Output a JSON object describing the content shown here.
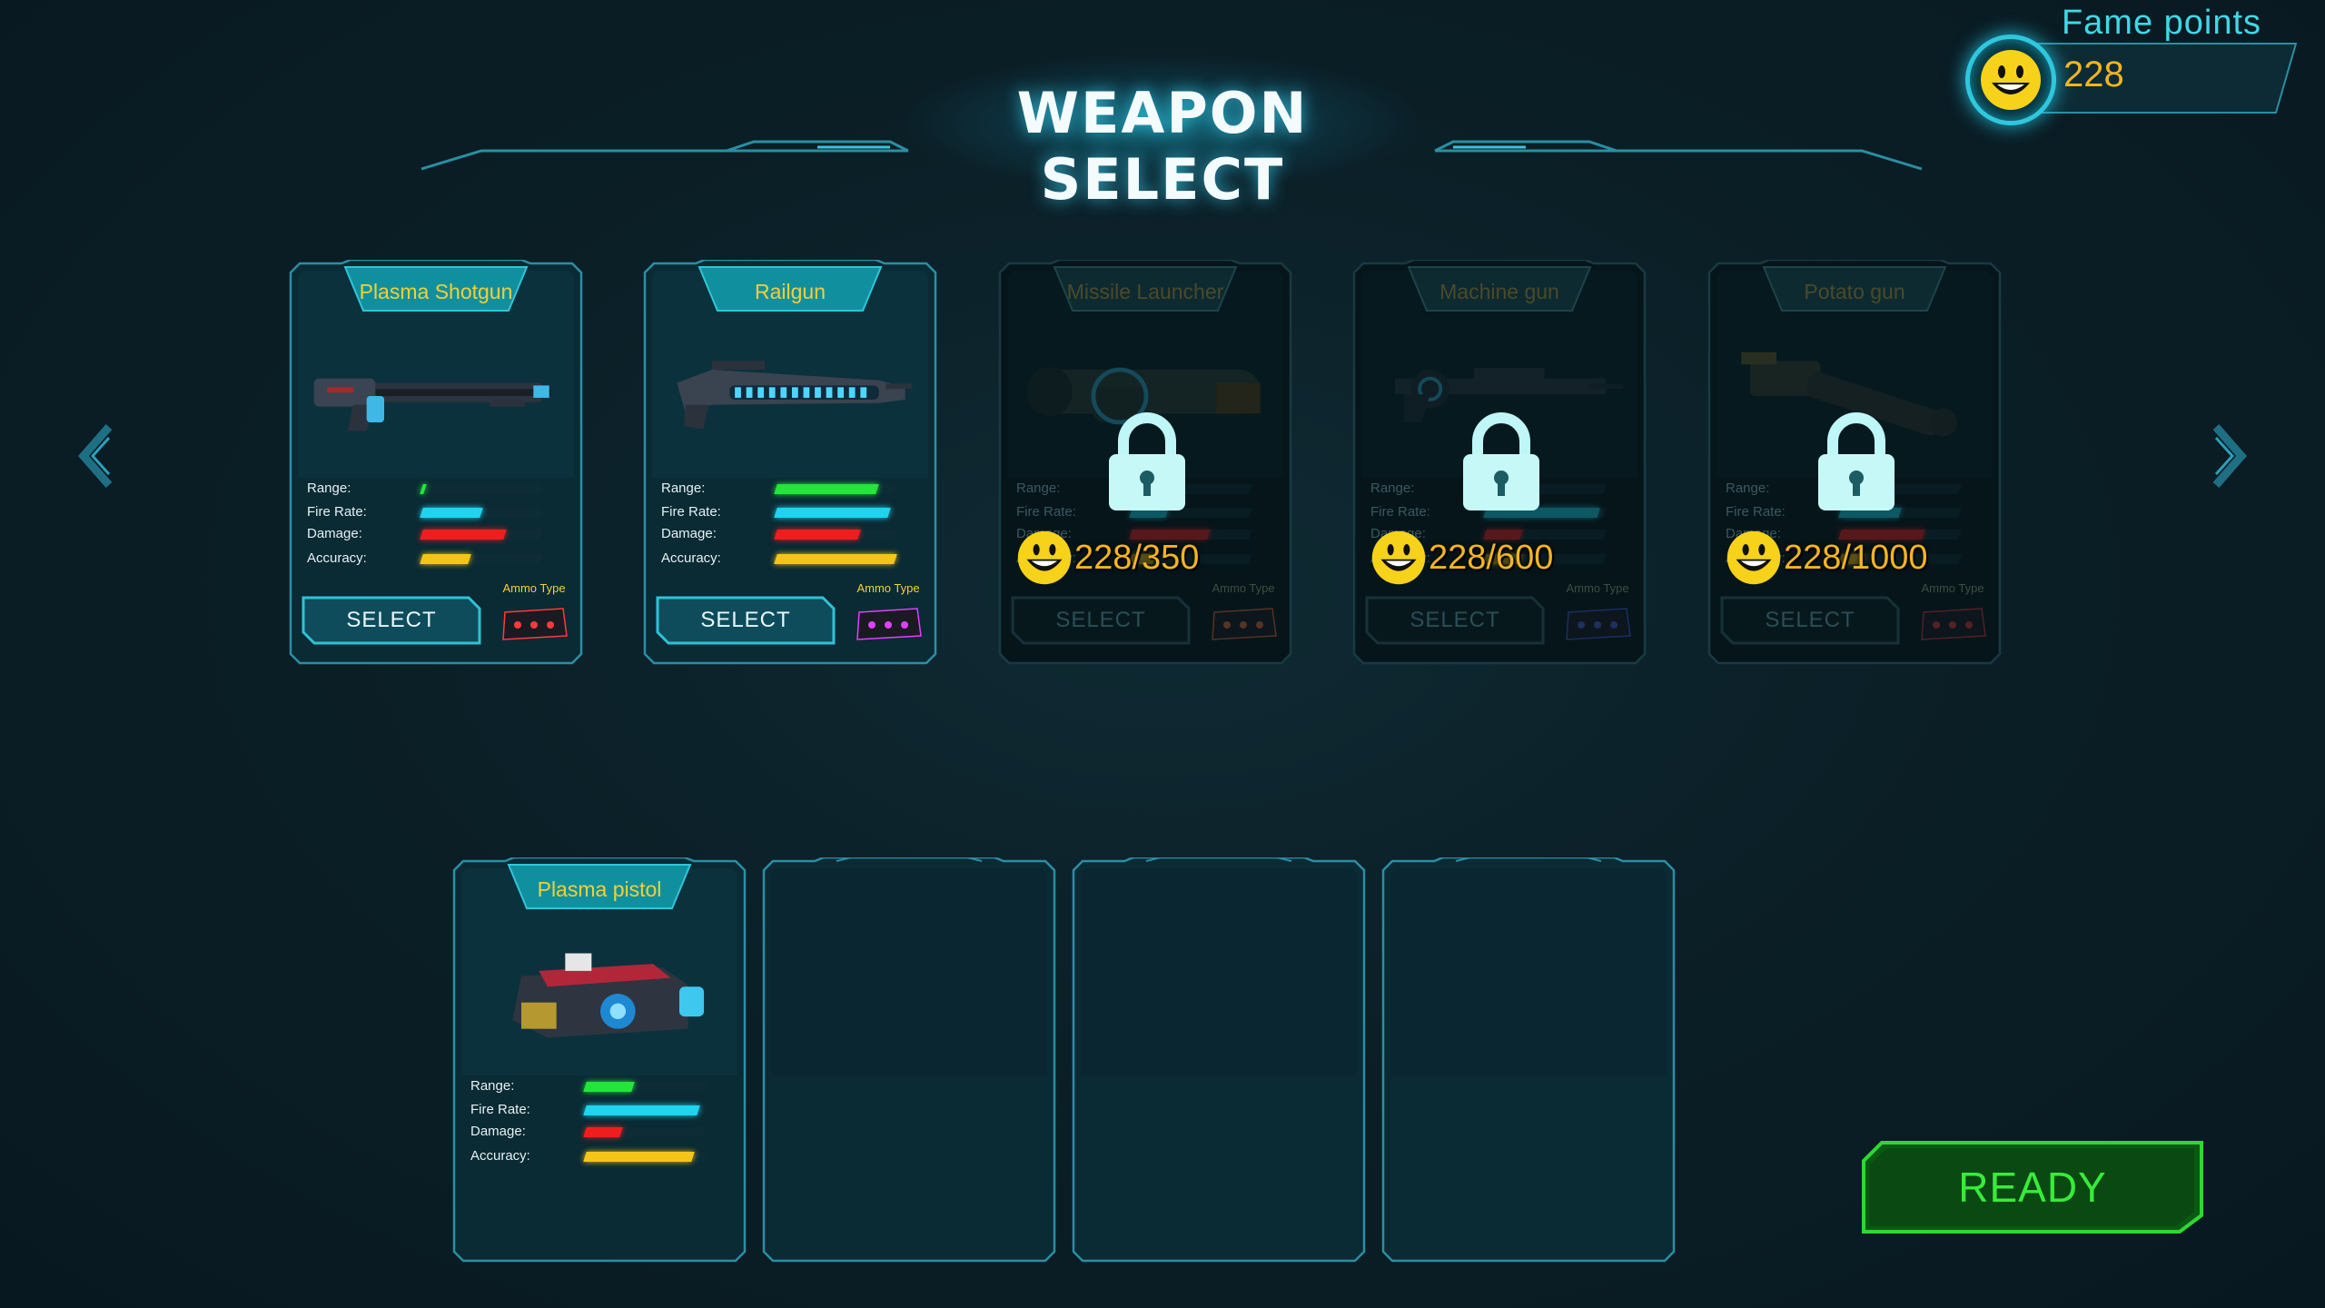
{
  "header": {
    "title": "WEAPON SELECT"
  },
  "fame": {
    "label": "Fame points",
    "value": "228",
    "icon": "smiley-coin-icon"
  },
  "navigation": {
    "prev_icon": "chevron-left-icon",
    "next_icon": "chevron-right-icon"
  },
  "stat_labels": {
    "range": "Range:",
    "fire_rate": "Fire Rate:",
    "damage": "Damage:",
    "accuracy": "Accuracy:"
  },
  "colors": {
    "range": "#23e53a",
    "fire_rate": "#1fd4ee",
    "damage": "#ee1e1e",
    "accuracy": "#f4c518",
    "accent": "#2ec8de",
    "ready": "#37ec3a",
    "title_gold": "#f5cf34"
  },
  "weapons": [
    {
      "name": "Plasma Shotgun",
      "locked": false,
      "select_label": "SELECT",
      "ammo_label": "Ammo Type",
      "stats": {
        "range": 0.03,
        "fire_rate": 0.5,
        "damage": 0.7,
        "accuracy": 0.4
      }
    },
    {
      "name": "Railgun",
      "locked": false,
      "select_label": "SELECT",
      "ammo_label": "Ammo Type",
      "stats": {
        "range": 0.85,
        "fire_rate": 0.95,
        "damage": 0.7,
        "accuracy": 1.0
      }
    },
    {
      "name": "Missile Launcher",
      "locked": true,
      "select_label": "SELECT",
      "ammo_label": "Ammo Type",
      "cost": "228/350",
      "stats": {
        "range": 0.2,
        "fire_rate": 0.3,
        "damage": 0.65,
        "accuracy": 0.2
      }
    },
    {
      "name": "Machine gun",
      "locked": true,
      "select_label": "SELECT",
      "ammo_label": "Ammo Type",
      "cost": "228/600",
      "stats": {
        "range": 0.4,
        "fire_rate": 0.95,
        "damage": 0.3,
        "accuracy": 0.3
      }
    },
    {
      "name": "Potato gun",
      "locked": true,
      "select_label": "SELECT",
      "ammo_label": "Ammo Type",
      "cost": "228/1000",
      "stats": {
        "range": 0.3,
        "fire_rate": 0.5,
        "damage": 0.7,
        "accuracy": 0.2
      }
    }
  ],
  "loadout": [
    {
      "name": "Plasma pistol",
      "stats": {
        "range": 0.4,
        "fire_rate": 0.95,
        "damage": 0.3,
        "accuracy": 0.9
      }
    },
    null,
    null,
    null
  ],
  "ready_label": "READY"
}
